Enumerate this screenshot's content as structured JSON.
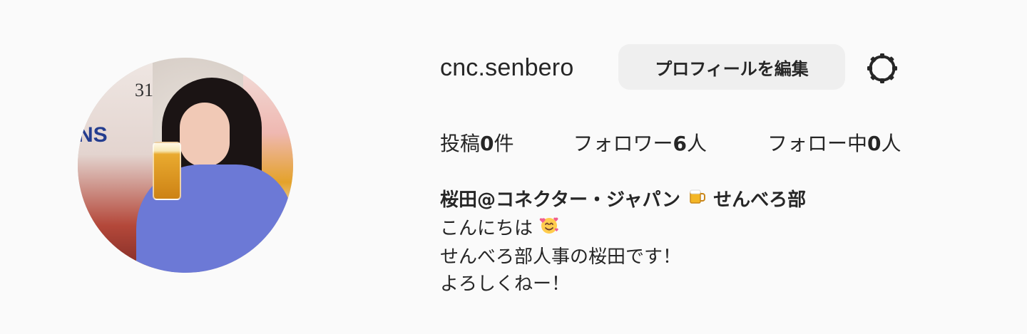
{
  "profile": {
    "username": "cnc.senbero",
    "edit_button_label": "プロフィールを編集",
    "settings_icon": "gear-icon",
    "avatar_alt": "profile-photo",
    "avatar_text": {
      "number": "31",
      "label": "NS"
    }
  },
  "stats": {
    "posts_prefix": "投稿",
    "posts_count": "0",
    "posts_suffix": "件",
    "followers_prefix": "フォロワー",
    "followers_count": "6",
    "followers_suffix": "人",
    "following_prefix": "フォロー中",
    "following_count": "0",
    "following_suffix": "人"
  },
  "bio": {
    "name_before_emoji": "桜田@コネクター・ジャパン",
    "name_after_emoji": "せんべろ部",
    "line1": "こんにちは",
    "line2": "せんべろ部人事の桜田です！",
    "line3": "よろしくねー！"
  },
  "icons": {
    "beer": "beer-mug-icon",
    "smile": "smiling-face-with-hearts-icon"
  }
}
